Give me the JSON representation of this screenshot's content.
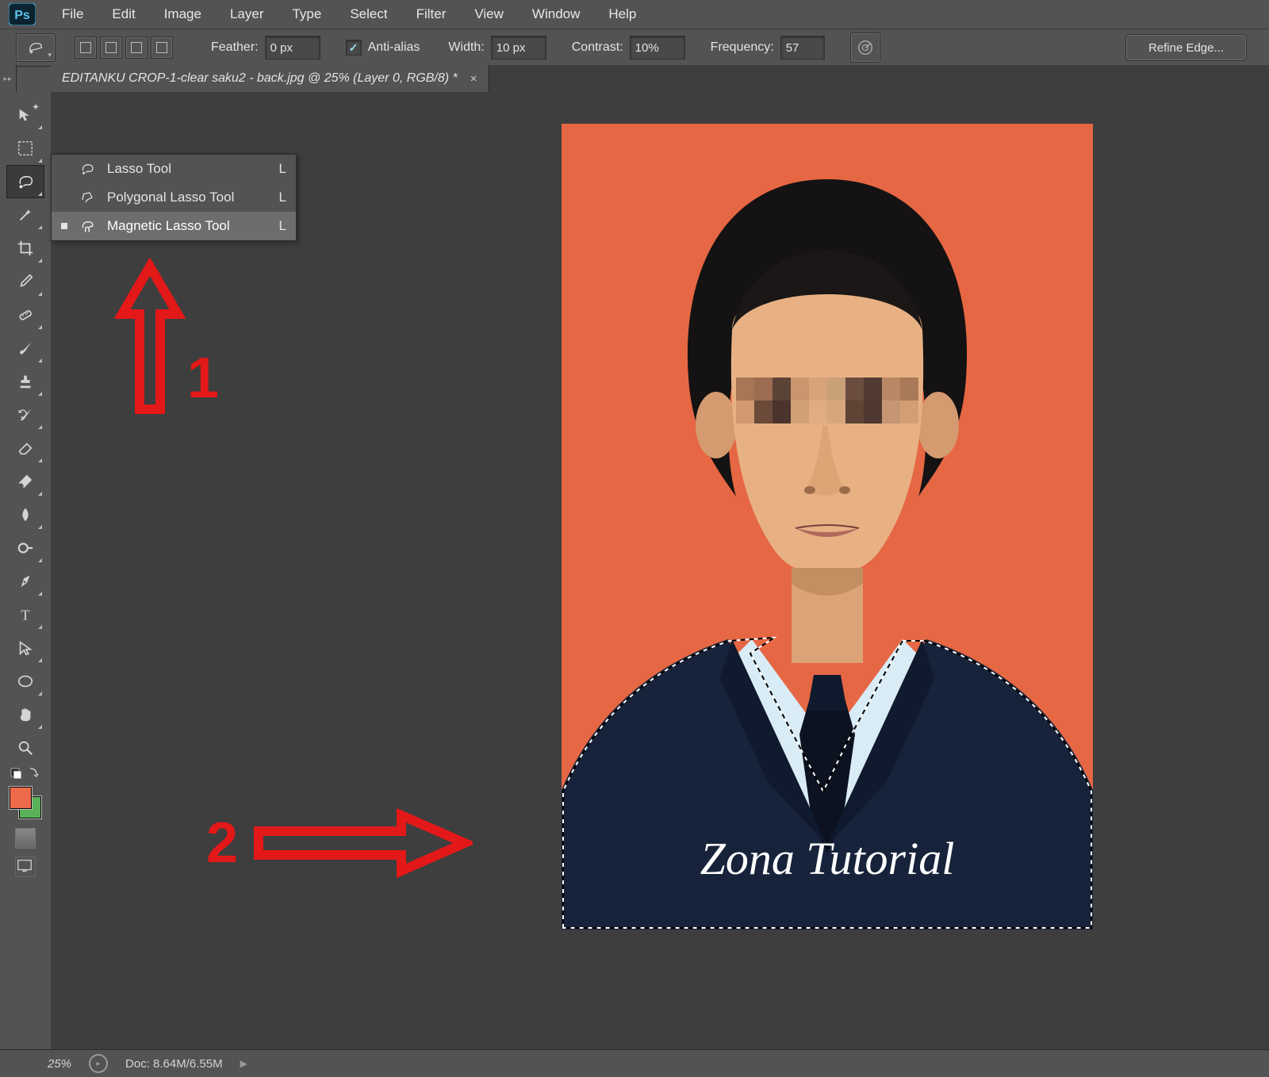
{
  "menu": [
    "File",
    "Edit",
    "Image",
    "Layer",
    "Type",
    "Select",
    "Filter",
    "View",
    "Window",
    "Help"
  ],
  "options": {
    "feather_label": "Feather:",
    "feather": "0 px",
    "antialias_label": "Anti-alias",
    "antialias": true,
    "width_label": "Width:",
    "width": "10 px",
    "contrast_label": "Contrast:",
    "contrast": "10%",
    "frequency_label": "Frequency:",
    "frequency": "57",
    "refine": "Refine Edge..."
  },
  "tab": {
    "title": "EDITANKU CROP-1-clear saku2 - back.jpg @ 25% (Layer 0, RGB/8) *",
    "close": "×"
  },
  "lasso_flyout": [
    {
      "label": "Lasso Tool",
      "key": "L",
      "selected": false
    },
    {
      "label": "Polygonal Lasso Tool",
      "key": "L",
      "selected": false
    },
    {
      "label": "Magnetic Lasso Tool",
      "key": "L",
      "selected": true
    }
  ],
  "status": {
    "zoom": "25%",
    "doc": "Doc: 8.64M/6.55M"
  },
  "swatch": {
    "fg": "#ed6b4a",
    "bg": "#59b159"
  },
  "annotations": {
    "one": "1",
    "two": "2"
  },
  "watermark": "Zona Tutorial"
}
